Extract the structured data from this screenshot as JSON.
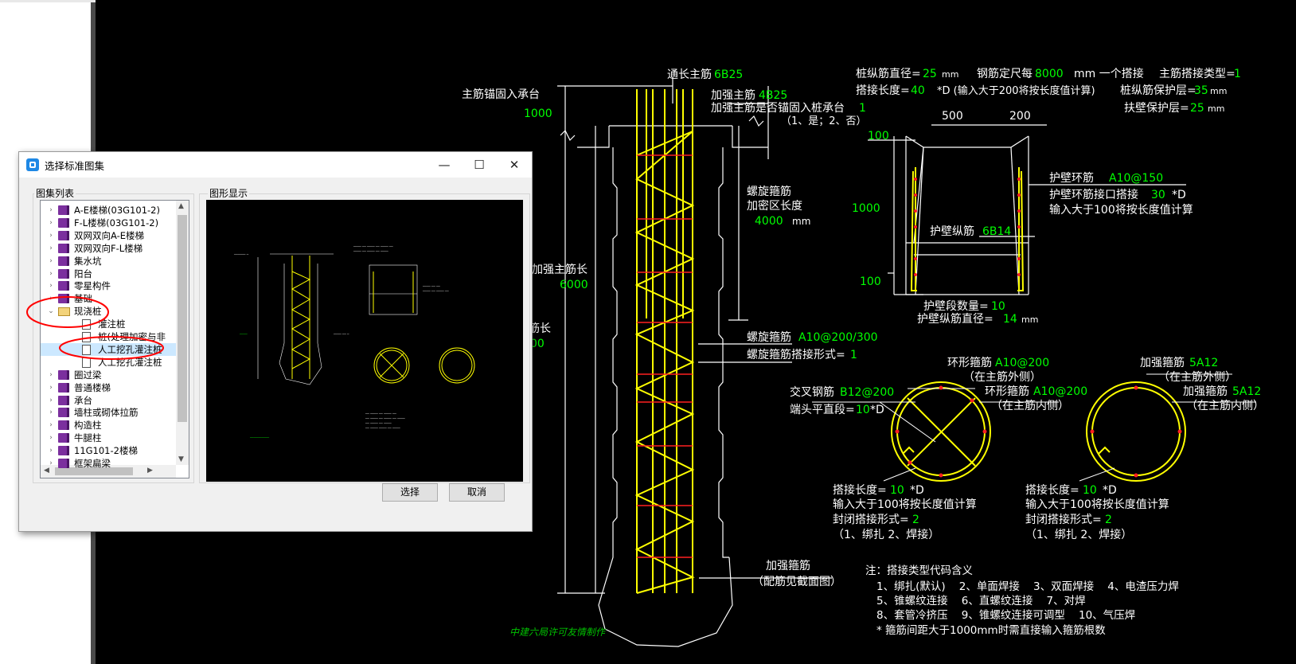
{
  "dialog": {
    "title": "选择标准图集",
    "tree_group_label": "图集列表",
    "preview_group_label": "图形显示",
    "select_button": "选择",
    "cancel_button": "取消",
    "tree_items": [
      {
        "label": "A-E楼梯(03G101-2)",
        "level": 1,
        "icon": "book-icon",
        "expander": "collapsed"
      },
      {
        "label": "F-L楼梯(03G101-2)",
        "level": 1,
        "icon": "book-icon",
        "expander": "collapsed"
      },
      {
        "label": "双网双向A-E楼梯",
        "level": 1,
        "icon": "book-icon",
        "expander": "collapsed"
      },
      {
        "label": "双网双向F-L楼梯",
        "level": 1,
        "icon": "book-icon",
        "expander": "collapsed"
      },
      {
        "label": "集水坑",
        "level": 1,
        "icon": "book-icon",
        "expander": "collapsed"
      },
      {
        "label": "阳台",
        "level": 1,
        "icon": "book-icon",
        "expander": "collapsed"
      },
      {
        "label": "零星构件",
        "level": 1,
        "icon": "book-icon",
        "expander": "collapsed"
      },
      {
        "label": "基础",
        "level": 1,
        "icon": "book-icon",
        "expander": "collapsed"
      },
      {
        "label": "现浇桩",
        "level": 1,
        "icon": "folder-open-icon",
        "expander": "expanded"
      },
      {
        "label": "灌注桩",
        "level": 2,
        "icon": "document-icon",
        "expander": "none"
      },
      {
        "label": "桩(处理加密与非",
        "level": 2,
        "icon": "document-icon",
        "expander": "none"
      },
      {
        "label": "人工挖孔灌注桩",
        "level": 2,
        "icon": "document-icon",
        "expander": "none",
        "selected": true
      },
      {
        "label": "人工挖孔灌注桩",
        "level": 2,
        "icon": "document-icon",
        "expander": "none"
      },
      {
        "label": "圈过梁",
        "level": 1,
        "icon": "book-icon",
        "expander": "collapsed"
      },
      {
        "label": "普通楼梯",
        "level": 1,
        "icon": "book-icon",
        "expander": "collapsed"
      },
      {
        "label": "承台",
        "level": 1,
        "icon": "book-icon",
        "expander": "collapsed"
      },
      {
        "label": "墙柱或砌体拉筋",
        "level": 1,
        "icon": "book-icon",
        "expander": "collapsed"
      },
      {
        "label": "构造柱",
        "level": 1,
        "icon": "book-icon",
        "expander": "collapsed"
      },
      {
        "label": "牛腿柱",
        "level": 1,
        "icon": "book-icon",
        "expander": "collapsed"
      },
      {
        "label": "11G101-2楼梯",
        "level": 1,
        "icon": "book-icon",
        "expander": "collapsed"
      },
      {
        "label": "框架扁梁",
        "level": 1,
        "icon": "book-icon",
        "expander": "collapsed"
      }
    ]
  },
  "drawing": {
    "pile": {
      "anchor_label": "主筋锚固入承台",
      "anchor_value": "1000",
      "through_bar_label": "通长主筋",
      "through_bar_value": "6B25",
      "reinforce_bar_label": "加强主筋",
      "reinforce_bar_value": "4B25",
      "reinforce_anchor_label": "加强主筋是否锚固入桩承台",
      "reinforce_anchor_value": "1",
      "reinforce_anchor_note": "（1、是；2、否）",
      "spiral_dense_label1": "螺旋箍筋",
      "spiral_dense_label2": "加密区长度",
      "spiral_dense_value": "4000",
      "spiral_dense_unit": "mm",
      "reinforce_length_label": "加强主筋长",
      "reinforce_length_value": "6000",
      "length_partial_label": "筋长",
      "length_partial_value": "00",
      "spiral_label": "螺旋箍筋",
      "spiral_value": "A10@200/300",
      "spiral_lap_label": "螺旋箍筋搭接形式=",
      "spiral_lap_value": "1",
      "stirrup_label": "加强箍筋",
      "stirrup_note": "（配筋见截面图）",
      "credit": "中建六局许可友情制作"
    },
    "params": {
      "diameter_label": "桩纵筋直径=",
      "diameter_value": "25",
      "diameter_unit": "mm",
      "fixed_length_label": "钢筋定尺每",
      "fixed_length_value": "8000",
      "fixed_length_unit": "mm 一个搭接",
      "lap_type_label": "主筋搭接类型=",
      "lap_type_value": "1",
      "lap_length_label": "搭接长度=",
      "lap_length_value": "40",
      "lap_length_note": "*D (输入大于200将按长度值计算)",
      "cover_label": "桩纵筋保护层=",
      "cover_value": "35",
      "cover_unit": "mm",
      "wall_cover_label": "扶壁保护层=",
      "wall_cover_value": "25",
      "wall_cover_unit": "mm"
    },
    "wall": {
      "dim_500": "500",
      "dim_200": "200",
      "dim_100_top": "100",
      "dim_1000": "1000",
      "dim_100_bottom": "100",
      "ring_label": "护壁环筋",
      "ring_value": "A10@150",
      "ring_lap_label": "护壁环筋接口搭接",
      "ring_lap_value": "30",
      "ring_lap_unit": "*D",
      "ring_lap_note": "输入大于100将按长度值计算",
      "long_bar_label": "护壁纵筋",
      "long_bar_value": "6B14",
      "segments_label": "护壁段数量=",
      "segments_value": "10",
      "long_dia_label": "护壁纵筋直径=",
      "long_dia_value": "14",
      "long_dia_unit": "mm"
    },
    "section_left": {
      "ring_outer_label": "环形箍筋",
      "ring_outer_value": "A10@200",
      "ring_outer_note": "（在主筋外侧）",
      "ring_inner_label": "环形箍筋",
      "ring_inner_value": "A10@200",
      "ring_inner_note": "（在主筋内侧）",
      "cross_label": "交叉钢筋",
      "cross_value": "B12@200",
      "end_label": "端头平直段=",
      "end_value": "10",
      "end_unit": "*D",
      "lap_label": "搭接长度=",
      "lap_value": "10",
      "lap_unit": "*D",
      "lap_note": "输入大于100将按长度值计算",
      "close_label": "封闭搭接形式=",
      "close_value": "2",
      "close_note": "（1、绑扎  2、焊接）"
    },
    "section_right": {
      "outer_label": "加强箍筋",
      "outer_value": "5A12",
      "outer_note": "（在主筋外侧）",
      "inner_label": "加强箍筋",
      "inner_value": "5A12",
      "inner_note": "（在主筋内侧）",
      "lap_label": "搭接长度=",
      "lap_value": "10",
      "lap_unit": "*D",
      "lap_note": "输入大于100将按长度值计算",
      "close_label": "封闭搭接形式=",
      "close_value": "2",
      "close_note": "（1、绑扎  2、焊接）"
    },
    "notes": {
      "title": "注：搭接类型代码含义",
      "line1": "1、绑扎(默认)    2、单面焊接    3、双面焊接    4、电渣压力焊",
      "line2": "5、锥螺纹连接    6、直螺纹连接    7、对焊",
      "line3": "8、套管冷挤压    9、锥螺纹连接可调型    10、气压焊",
      "line4": "* 箍筋间距大于1000mm时需直接输入箍筋根数"
    }
  },
  "colors": {
    "cad_background": "#000000",
    "cad_lines": "#ffffff",
    "cad_values": "#00ff00",
    "rebar": "#ffff00",
    "stirrup": "#ff0000",
    "annotation_circle": "#ff0000"
  }
}
